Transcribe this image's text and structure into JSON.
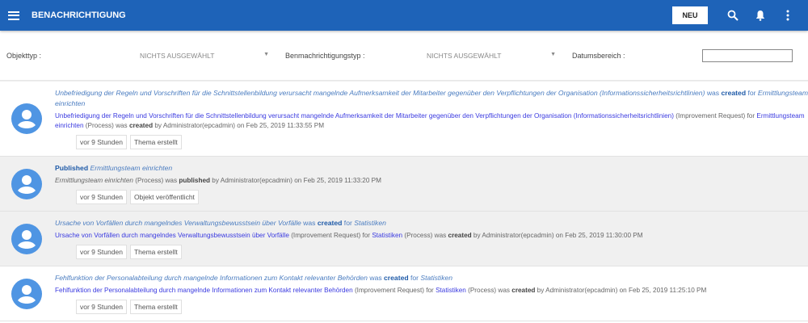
{
  "header": {
    "title": "BENACHRICHTIGUNG",
    "new_label": "NEU"
  },
  "filters": {
    "object_type_label": "Objekttyp :",
    "object_type_value": "NICHTS AUSGEWÄHLT",
    "notification_type_label": "Benmachrichtigungstyp :",
    "notification_type_value": "NICHTS AUSGEWÄHLT",
    "date_range_label": "Datumsbereich :",
    "date_range_value": ""
  },
  "notifications": [
    {
      "shaded": false,
      "line1": [
        {
          "t": "Unbefriedigung der Regeln und Vorschriften für die Schnittstellenbildung verursacht mangelnde Aufmerksamkeit der Mitarbeiter gegenüber den Verpflichtungen der Organisation (Informationssicherheitsrichtlinien)",
          "c": "it"
        },
        {
          "t": " was ",
          "c": "tx"
        },
        {
          "t": "created",
          "c": "b"
        },
        {
          "t": " for ",
          "c": "tx"
        },
        {
          "t": "Ermittlungsteam einrichten",
          "c": "it"
        }
      ],
      "line2": [
        {
          "t": "Unbefriedigung der Regeln und Vorschriften für die Schnittstellenbildung verursacht mangelnde Aufmerksamkeit der Mitarbeiter gegenüber den Verpflichtungen der Organisation (Informationssicherheitsrichtlinien)",
          "c": "lk"
        },
        {
          "t": " (Improvement Request) for ",
          "c": "tx"
        },
        {
          "t": "Ermittlungsteam einrichten",
          "c": "lk"
        },
        {
          "t": " (Process) was ",
          "c": "tx"
        },
        {
          "t": "created",
          "c": "bb"
        },
        {
          "t": " by Administrator(epcadmin) on Feb 25, 2019 11:33:55 PM",
          "c": "tx"
        }
      ],
      "time": "vor 9 Stunden",
      "tag": "Thema erstellt"
    },
    {
      "shaded": true,
      "line1": [
        {
          "t": "Published",
          "c": "b"
        },
        {
          "t": " ",
          "c": "tx"
        },
        {
          "t": "Ermittlungsteam einrichten",
          "c": "it"
        }
      ],
      "line2": [
        {
          "t": "Ermittlungsteam einrichten",
          "c": "tx it2"
        },
        {
          "t": " (Process) was ",
          "c": "tx"
        },
        {
          "t": "published",
          "c": "bb"
        },
        {
          "t": " by Administrator(epcadmin) on Feb 25, 2019 11:33:20 PM",
          "c": "tx"
        }
      ],
      "time": "vor 9 Stunden",
      "tag": "Objekt veröffentlicht"
    },
    {
      "shaded": true,
      "line1": [
        {
          "t": "Ursache von Vorfällen durch mangelndes Verwaltungsbewusstsein über Vorfälle",
          "c": "it"
        },
        {
          "t": " was ",
          "c": "tx"
        },
        {
          "t": "created",
          "c": "b"
        },
        {
          "t": " for ",
          "c": "tx"
        },
        {
          "t": "Statistiken",
          "c": "it"
        }
      ],
      "line2": [
        {
          "t": "Ursache von Vorfällen durch mangelndes Verwaltungsbewusstsein über Vorfälle",
          "c": "lk"
        },
        {
          "t": " (Improvement Request) for ",
          "c": "tx"
        },
        {
          "t": "Statistiken",
          "c": "lk"
        },
        {
          "t": " (Process) was ",
          "c": "tx"
        },
        {
          "t": "created",
          "c": "bb"
        },
        {
          "t": " by Administrator(epcadmin) on Feb 25, 2019 11:30:00 PM",
          "c": "tx"
        }
      ],
      "time": "vor 9 Stunden",
      "tag": "Thema erstellt"
    },
    {
      "shaded": false,
      "line1": [
        {
          "t": "Fehlfunktion der Personalabteilung durch mangelnde Informationen zum Kontakt relevanter Behörden",
          "c": "it"
        },
        {
          "t": " was ",
          "c": "tx"
        },
        {
          "t": "created",
          "c": "b"
        },
        {
          "t": " for ",
          "c": "tx"
        },
        {
          "t": "Statistiken",
          "c": "it"
        }
      ],
      "line2": [
        {
          "t": "Fehlfunktion der Personalabteilung durch mangelnde Informationen zum Kontakt relevanter Behörden",
          "c": "lk"
        },
        {
          "t": " (Improvement Request) for ",
          "c": "tx"
        },
        {
          "t": "Statistiken",
          "c": "lk"
        },
        {
          "t": " (Process) was ",
          "c": "tx"
        },
        {
          "t": "created",
          "c": "bb"
        },
        {
          "t": " by Administrator(epcadmin) on Feb 25, 2019 11:25:10 PM",
          "c": "tx"
        }
      ],
      "time": "vor 9 Stunden",
      "tag": "Thema erstellt"
    }
  ]
}
